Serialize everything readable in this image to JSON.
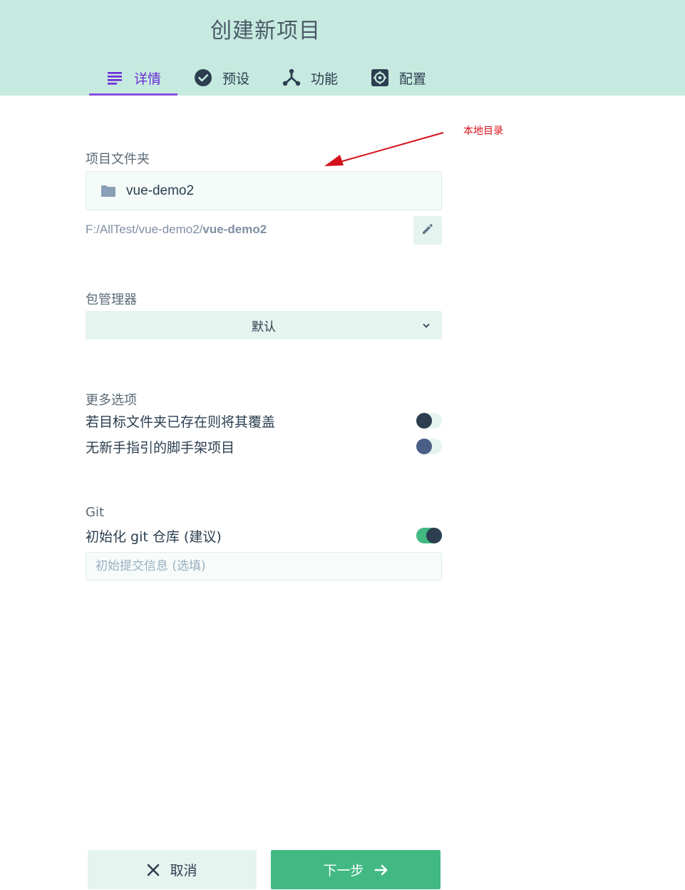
{
  "header": {
    "title": "创建新项目",
    "tabs": [
      {
        "label": "详情",
        "icon": "details-icon",
        "active": true
      },
      {
        "label": "预设",
        "icon": "check-circle-icon",
        "active": false
      },
      {
        "label": "功能",
        "icon": "fork-icon",
        "active": false
      },
      {
        "label": "配置",
        "icon": "gear-icon",
        "active": false
      }
    ]
  },
  "annotation": {
    "text": "本地目录",
    "color": "#d4121b"
  },
  "folder": {
    "label": "项目文件夹",
    "name": "vue-demo2",
    "path_prefix": "F:/AllTest/vue-demo2/",
    "path_name": "vue-demo2"
  },
  "package_manager": {
    "label": "包管理器",
    "value": "默认"
  },
  "more_options": {
    "label": "更多选项",
    "options": [
      {
        "text": "若目标文件夹已存在则将其覆盖",
        "enabled": false
      },
      {
        "text": "无新手指引的脚手架项目",
        "enabled": false
      }
    ]
  },
  "git": {
    "label": "Git",
    "init_text": "初始化 git 仓库 (建议)",
    "init_enabled": true,
    "commit_placeholder": "初始提交信息 (选填)"
  },
  "footer": {
    "cancel_label": "取消",
    "next_label": "下一步"
  },
  "colors": {
    "header_bg": "#c6eadf",
    "accent": "#6b2bd6",
    "primary": "#42b983",
    "light": "#e5f4ef"
  }
}
